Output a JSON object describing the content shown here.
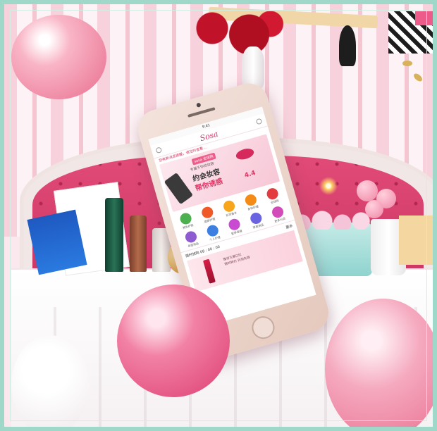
{
  "scene": {
    "description_colors": {
      "border": "#9fd8c8",
      "brand_pink": "#e0386c",
      "stripe_pink": "#f7d2dc"
    }
  },
  "phone": {
    "status_bar": {
      "time": "9:41"
    },
    "app": {
      "logo": "Sosa",
      "notice": "您有新消息提醒，请及时查看...",
      "banner": {
        "badge": "sosa 全球购",
        "subtitle": "专属于你的妆容",
        "title_line1": "约会妆容",
        "title_line2": "帮你诱惑",
        "date": "4.4"
      },
      "icons": [
        {
          "label": "美妆护肤",
          "color": "#4caf50"
        },
        {
          "label": "面部护理",
          "color": "#f05a28"
        },
        {
          "label": "彩妆香水",
          "color": "#f7a51d"
        },
        {
          "label": "身体护理",
          "color": "#f38b16"
        },
        {
          "label": "全球购",
          "color": "#e23b40"
        },
        {
          "label": "母婴用品",
          "color": "#8e5bd1"
        },
        {
          "label": "个人护理",
          "color": "#3d7fe0"
        },
        {
          "label": "营养保健",
          "color": "#c94bd1"
        },
        {
          "label": "家居用品",
          "color": "#6b64e0"
        },
        {
          "label": "更多分类",
          "color": "#d24bb8"
        }
      ],
      "section": {
        "title": "限时抢购 08 : 00 : 00",
        "more": "更多"
      },
      "promo": {
        "line1": "雅诗兰黛口红",
        "line2": "限时特价 先到先得"
      }
    }
  }
}
